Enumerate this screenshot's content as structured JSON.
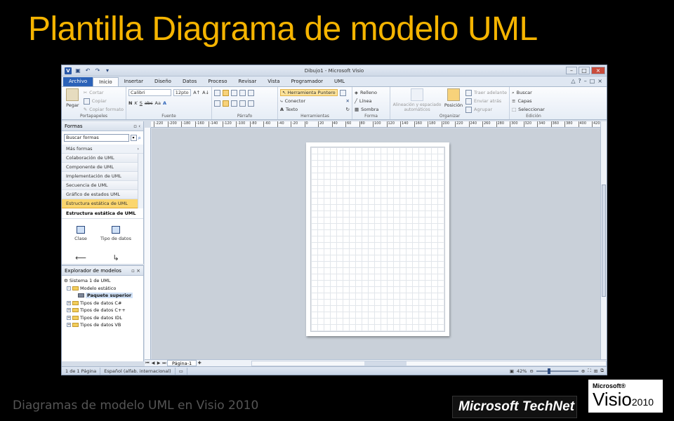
{
  "slide": {
    "title": "Plantilla Diagrama de modelo UML",
    "caption": "Diagramas de modelo UML en Visio 2010",
    "technet_logo": "Microsoft TechNet",
    "visio_logo_brand": "Microsoft®",
    "visio_logo_name": "Visio",
    "visio_logo_year": "2010",
    "title_color": "#f5b400"
  },
  "window": {
    "title": "Dibujo1 - Microsoft Visio"
  },
  "tabs": [
    "Archivo",
    "Inicio",
    "Insertar",
    "Diseño",
    "Datos",
    "Proceso",
    "Revisar",
    "Vista",
    "Programador",
    "UML"
  ],
  "ribbon": {
    "portapapeles": {
      "label": "Portapapeles",
      "paste": "Pegar",
      "cut": "Cortar",
      "copy": "Copiar",
      "copy_format": "Copiar formato"
    },
    "fuente": {
      "label": "Fuente",
      "font": "Calibri",
      "size": "12pto",
      "bold": "N",
      "italic": "K",
      "strike": "abc",
      "case": "Aa",
      "color": "A"
    },
    "parrafo": {
      "label": "Párrafo"
    },
    "herramientas": {
      "label": "Herramientas",
      "pointer": "Herramienta Puntero",
      "connector": "Conector",
      "text": "Texto"
    },
    "forma": {
      "label": "Forma",
      "fill": "Relleno",
      "line": "Línea",
      "shadow": "Sombra"
    },
    "organizar": {
      "label": "Organizar",
      "auto_align": "Alineación y espaciado automáticos",
      "position": "Posición",
      "bring_forward": "Traer adelante",
      "send_back": "Enviar atrás",
      "group": "Agrupar"
    },
    "edicion": {
      "label": "Edición",
      "find": "Buscar",
      "layers": "Capas",
      "select": "Seleccionar"
    }
  },
  "shapes_pane": {
    "title": "Formas",
    "search_placeholder": "Buscar formas",
    "more": "Más formas",
    "stencils": [
      "Colaboración de UML",
      "Componente de UML",
      "Implementación de UML",
      "Secuencia de UML",
      "Gráfico de estados UML",
      "Estructura estática de UML"
    ],
    "active_stencil_title": "Estructura estática de UML",
    "shapes": [
      "Clase",
      "Tipo de datos"
    ]
  },
  "explorer": {
    "title": "Explorador de modelos",
    "nodes": [
      {
        "label": "Sistema 1 de UML",
        "level": 0
      },
      {
        "label": "Modelo estático",
        "level": 1
      },
      {
        "label": "Paquete superior",
        "level": 2
      },
      {
        "label": "Tipos de datos C#",
        "level": 1
      },
      {
        "label": "Tipos de datos C++",
        "level": 1
      },
      {
        "label": "Tipos de datos IDL",
        "level": 1
      },
      {
        "label": "Tipos de datos VB",
        "level": 1
      }
    ]
  },
  "ruler_labels": [
    "-220",
    "-200",
    "-180",
    "-160",
    "-140",
    "-120",
    "-100",
    "-80",
    "-60",
    "-40",
    "-20",
    "0",
    "20",
    "40",
    "60",
    "80",
    "100",
    "120",
    "140",
    "160",
    "180",
    "200",
    "220",
    "240",
    "260",
    "280",
    "300",
    "320",
    "340",
    "360",
    "380",
    "400",
    "420"
  ],
  "page_tab": "Página-1",
  "status": {
    "page": "1 de 1 Página",
    "language": "Español (alfab. internacional)",
    "zoom": "42%"
  }
}
